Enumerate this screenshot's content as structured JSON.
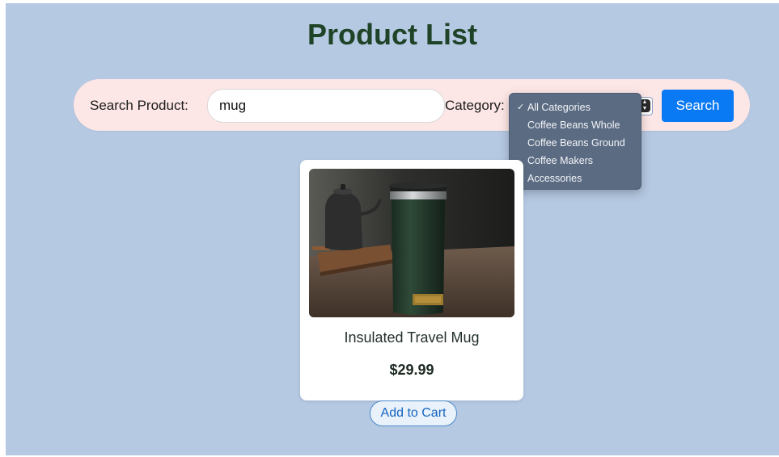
{
  "page": {
    "title": "Product List"
  },
  "search": {
    "label": "Search Product:",
    "value": "mug"
  },
  "category": {
    "label": "Category:",
    "selected": "All Categories",
    "options": [
      {
        "label": "All Categories",
        "checked": true
      },
      {
        "label": "Coffee Beans Whole",
        "checked": false
      },
      {
        "label": "Coffee Beans Ground",
        "checked": false
      },
      {
        "label": "Coffee Makers",
        "checked": false
      },
      {
        "label": "Accessories",
        "checked": false
      }
    ],
    "check_glyph": "✓"
  },
  "search_button": {
    "label": "Search"
  },
  "products": [
    {
      "name": "Insulated Travel Mug",
      "price": "$29.99",
      "add_to_cart_label": "Add to Cart"
    }
  ],
  "colors": {
    "background": "#b6c9e3",
    "title": "#1f4327",
    "search_bar": "#fde6e6",
    "primary_button": "#0a79f4",
    "dropdown": "#5b6b82",
    "mug_body": "#253a2c"
  }
}
